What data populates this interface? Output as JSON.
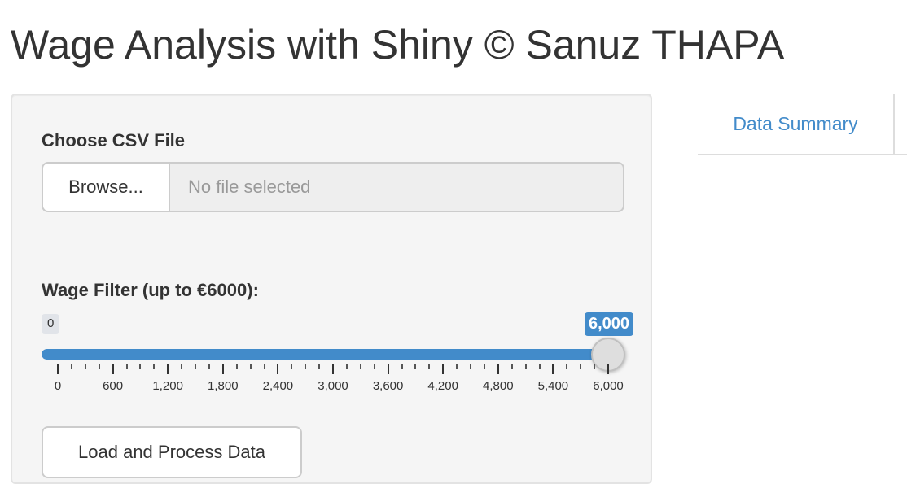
{
  "title": "Wage Analysis with Shiny © Sanuz THAPA",
  "sidebar": {
    "file_input": {
      "label": "Choose CSV File",
      "browse_label": "Browse...",
      "placeholder": "No file selected"
    },
    "wage_slider": {
      "label": "Wage Filter (up to €6000):",
      "min": 0,
      "max": 6000,
      "value": 6000,
      "min_badge": "0",
      "value_badge": "6,000",
      "tick_labels": [
        "0",
        "600",
        "1,200",
        "1,800",
        "2,400",
        "3,000",
        "3,600",
        "4,200",
        "4,800",
        "5,400",
        "6,000"
      ],
      "accent_color": "#428bca"
    },
    "action_button_label": "Load and Process Data"
  },
  "tabs": [
    {
      "label": "Data Summary",
      "icon": "none"
    }
  ]
}
